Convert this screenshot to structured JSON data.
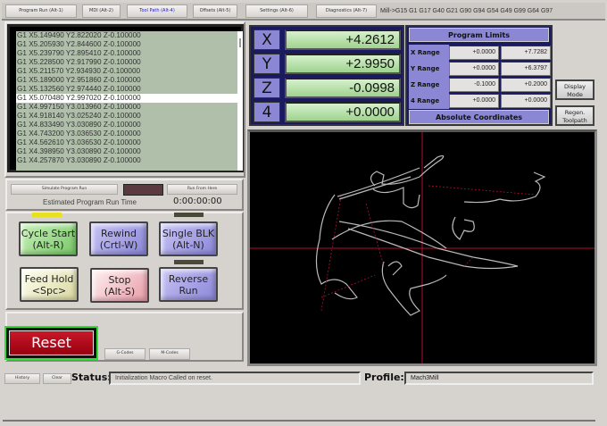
{
  "tabs": [
    {
      "label": "Program Run (Alt-1)"
    },
    {
      "label": "MDI (Alt-2)"
    },
    {
      "label": "Tool Path (Alt-4)",
      "active": true
    },
    {
      "label": "Offsets (Alt-5)"
    },
    {
      "label": "Settings (Alt-6)"
    },
    {
      "label": "Diagnostics (Alt-7)"
    }
  ],
  "modal_line": "Mill->G15  G1 G17 G40 G21 G90 G94 G54 G49 G99 G64 G97",
  "gcode_lines": [
    "G1 X5.149490 Y2.822020 Z-0.100000",
    "G1 X5.205930 Y2.844600 Z-0.100000",
    "G1 X5.239790 Y2.895410 Z-0.100000",
    "G1 X5.228500 Y2.917990 Z-0.100000",
    "G1 X5.211570 Y2.934930 Z-0.100000",
    "G1 X5.189000 Y2.951860 Z-0.100000",
    "G1 X5.132560 Y2.974440 Z-0.100000",
    "G1 X5.070480 Y2.997020 Z-0.100000",
    "G1 X4.997150 Y3.013960 Z-0.100000",
    "G1 X4.918140 Y3.025240 Z-0.100000",
    "G1 X4.833490 Y3.030890 Z-0.100000",
    "G1 X4.743200 Y3.036530 Z-0.100000",
    "G1 X4.562610 Y3.036530 Z-0.100000",
    "G1 X4.398950 Y3.030890 Z-0.100000",
    "G1 X4.257870 Y3.030890 Z-0.100000"
  ],
  "current_line_index": 7,
  "simulate_label": "Simulate Program Run",
  "run_from_here_label": "Run From Here",
  "est_label": "Estimated Program Run Time",
  "est_time": "0:00:00:00",
  "buttons": {
    "cycle_start": [
      "Cycle Start",
      "(Alt-R)"
    ],
    "rewind": [
      "Rewind",
      "(Crtl-W)"
    ],
    "single_blk": [
      "Single BLK",
      "(Alt-N)"
    ],
    "feed_hold": [
      "Feed Hold",
      "<Spc>"
    ],
    "stop": [
      "Stop",
      "(Alt-S)"
    ],
    "reverse_run": [
      "Reverse",
      "Run"
    ]
  },
  "reset_label": "Reset",
  "gcodes_label": "G-Codes",
  "mcodes_label": "M-Codes",
  "dro": [
    {
      "axis": "X",
      "value": "+4.2612"
    },
    {
      "axis": "Y",
      "value": "+2.9950"
    },
    {
      "axis": "Z",
      "value": "-0.0998"
    },
    {
      "axis": "4",
      "value": "+0.0000"
    }
  ],
  "limits": {
    "title": "Program Limits",
    "footer": "Absolute Coordinates",
    "rows": [
      {
        "label": "X Range",
        "min": "+0.0000",
        "max": "+7.7282"
      },
      {
        "label": "Y Range",
        "min": "+0.0000",
        "max": "+6.3797"
      },
      {
        "label": "Z Range",
        "min": "-0.1000",
        "max": "+0.2000"
      },
      {
        "label": "4 Range",
        "min": "+0.0000",
        "max": "+0.0000"
      }
    ]
  },
  "display_mode": [
    "Display",
    "Mode"
  ],
  "regen": [
    "Regen.",
    "Toolpath"
  ],
  "history_label": "History",
  "clear_label": "Clear",
  "status_label": "Status:",
  "status_text": "Initialization Macro Called on reset.",
  "profile_label": "Profile:",
  "profile_text": "Mach3Mill",
  "colors": {
    "dro_label": "#8b87d4",
    "dro_value": "#b4e0a4",
    "reset": "#b00010",
    "crosshair": "#b01030"
  }
}
